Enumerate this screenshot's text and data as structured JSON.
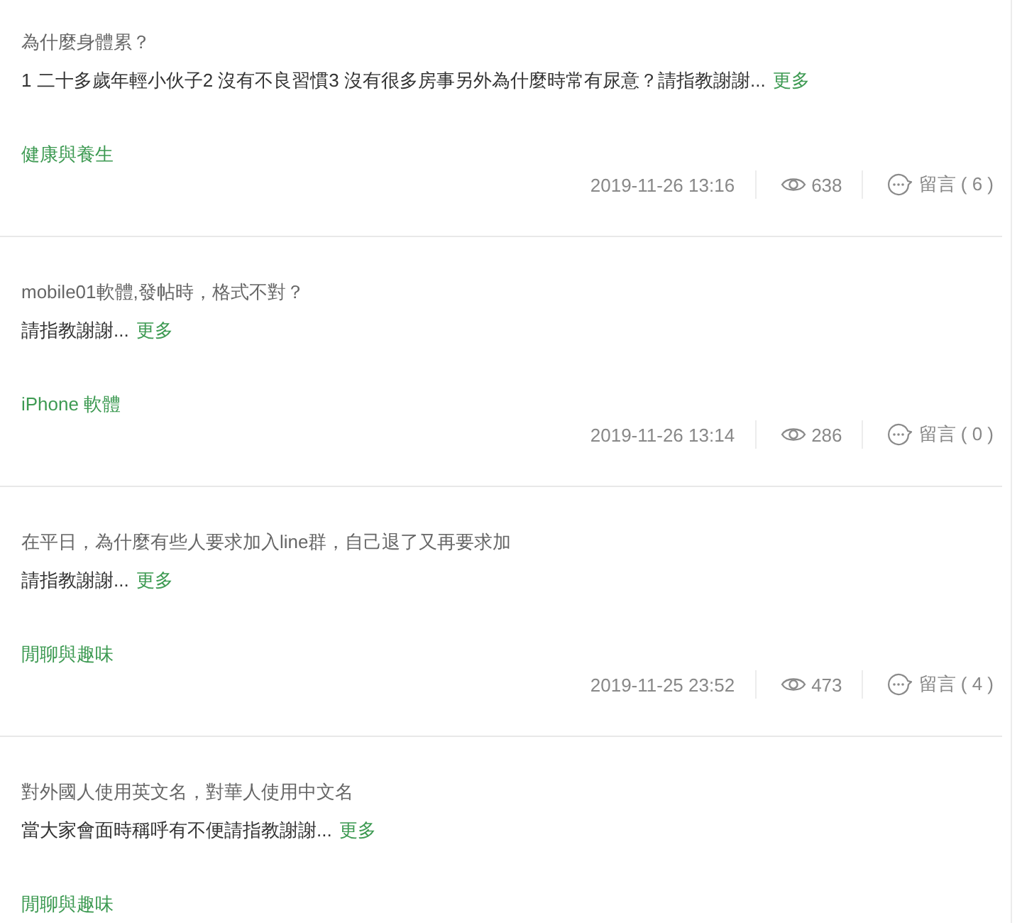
{
  "posts": [
    {
      "title": "為什麼身體累？",
      "excerpt": "1 二十多歲年輕小伙子2 沒有不良習慣3 沒有很多房事另外為什麼時常有尿意？請指教謝謝...",
      "more": "更多",
      "category": "健康與養生",
      "date": "2019-11-26 13:16",
      "views": "638",
      "comments": "留言 ( 6 )"
    },
    {
      "title": "mobile01軟體,發帖時，格式不對？",
      "excerpt": "請指教謝謝...",
      "more": "更多",
      "category": "iPhone 軟體",
      "date": "2019-11-26 13:14",
      "views": "286",
      "comments": "留言 ( 0 )"
    },
    {
      "title": "在平日，為什麼有些人要求加入line群，自己退了又再要求加",
      "excerpt": "請指教謝謝...",
      "more": "更多",
      "category": "閒聊與趣味",
      "date": "2019-11-25 23:52",
      "views": "473",
      "comments": "留言 ( 4 )"
    },
    {
      "title": "對外國人使用英文名，對華人使用中文名",
      "excerpt": "當大家會面時稱呼有不便請指教謝謝...",
      "more": "更多",
      "category": "閒聊與趣味"
    }
  ]
}
